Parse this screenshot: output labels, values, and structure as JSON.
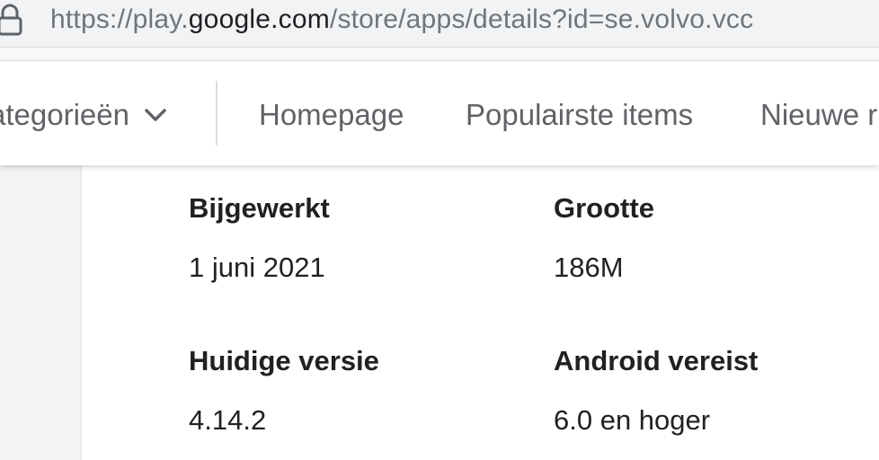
{
  "browser": {
    "url_prefix": "https://play.",
    "url_domain": "google.com",
    "url_path": "/store/apps/details?id=se.volvo.vcc",
    "lock_icon": "lock-icon"
  },
  "navbar": {
    "categories_label": "ategorieën",
    "categories_icon": "chevron-down-icon",
    "links": [
      {
        "label": "Homepage"
      },
      {
        "label": "Populairste items"
      },
      {
        "label": "Nieuwe r"
      }
    ]
  },
  "app_info": {
    "updated_label": "Bijgewerkt",
    "updated_value": "1 juni 2021",
    "size_label": "Grootte",
    "size_value": "186M",
    "version_label": "Huidige versie",
    "version_value": "4.14.2",
    "android_label": "Android vereist",
    "android_value": "6.0 en hoger"
  }
}
